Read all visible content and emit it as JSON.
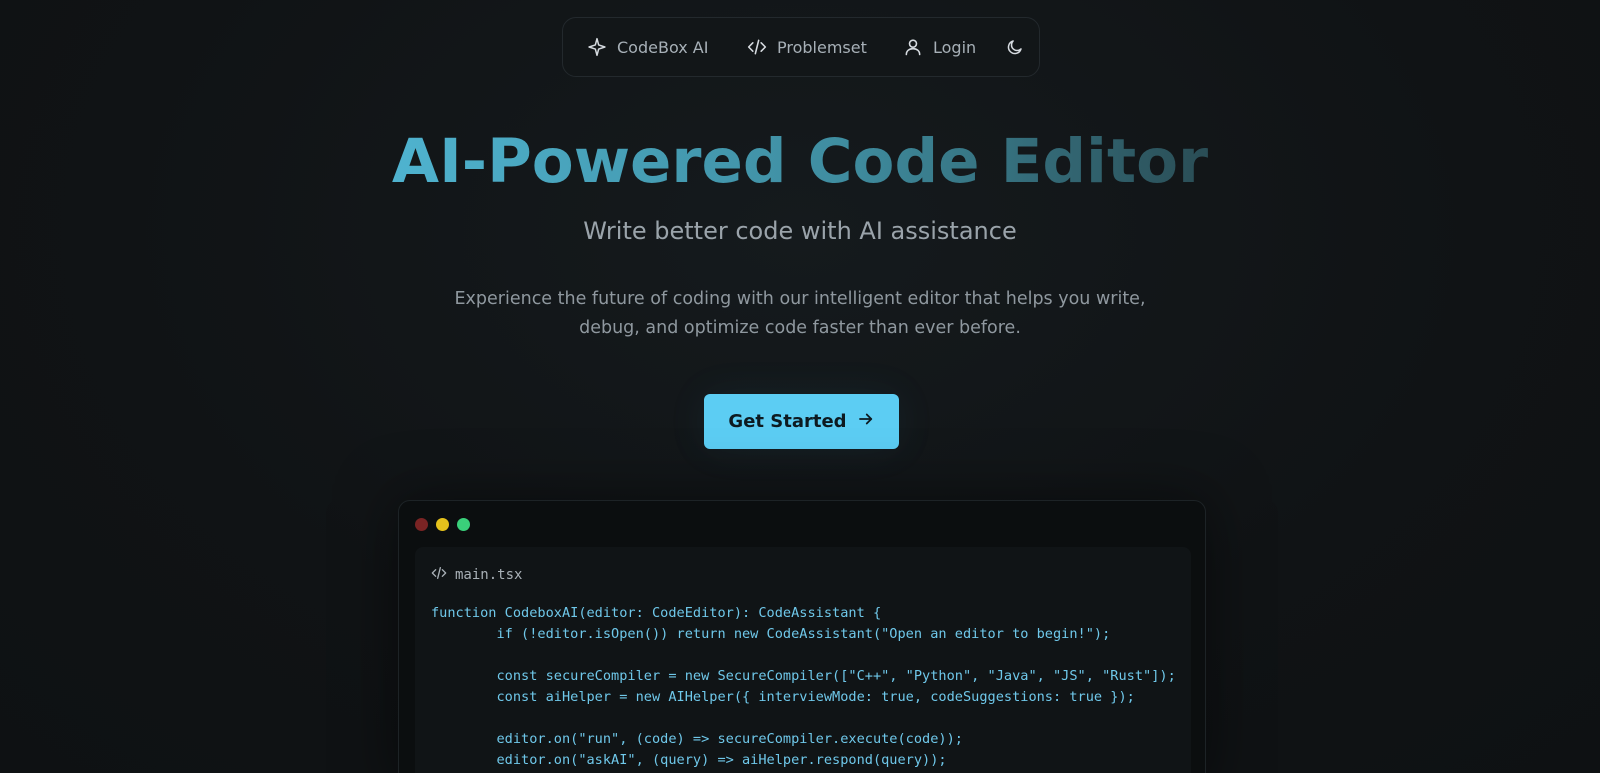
{
  "nav": {
    "brand_label": "CodeBox AI",
    "problemset_label": "Problemset",
    "login_label": "Login",
    "icons": {
      "brand": "sparkle-icon",
      "problemset": "code-icon",
      "login": "user-icon",
      "theme": "moon-icon"
    }
  },
  "hero": {
    "title": "AI-Powered Code Editor",
    "subtitle": "Write better code with AI assistance",
    "description": "Experience the future of coding with our intelligent editor that helps you write, debug, and optimize code faster than ever before.",
    "cta_label": "Get Started"
  },
  "editor": {
    "filename": "main.tsx",
    "lines": [
      "function CodeboxAI(editor: CodeEditor): CodeAssistant {",
      "        if (!editor.isOpen()) return new CodeAssistant(\"Open an editor to begin!\");",
      "",
      "        const secureCompiler = new SecureCompiler([\"C++\", \"Python\", \"Java\", \"JS\", \"Rust\"]);",
      "        const aiHelper = new AIHelper({ interviewMode: true, codeSuggestions: true });",
      "",
      "        editor.on(\"run\", (code) => secureCompiler.execute(code));",
      "        editor.on(\"askAI\", (query) => aiHelper.respond(query));"
    ]
  },
  "colors": {
    "accent": "#5ccdf3",
    "background": "#111518",
    "code_text": "#6fc8ea",
    "dot_red": "#7a2424",
    "dot_yellow": "#e5c21c",
    "dot_green": "#3ad07a"
  }
}
